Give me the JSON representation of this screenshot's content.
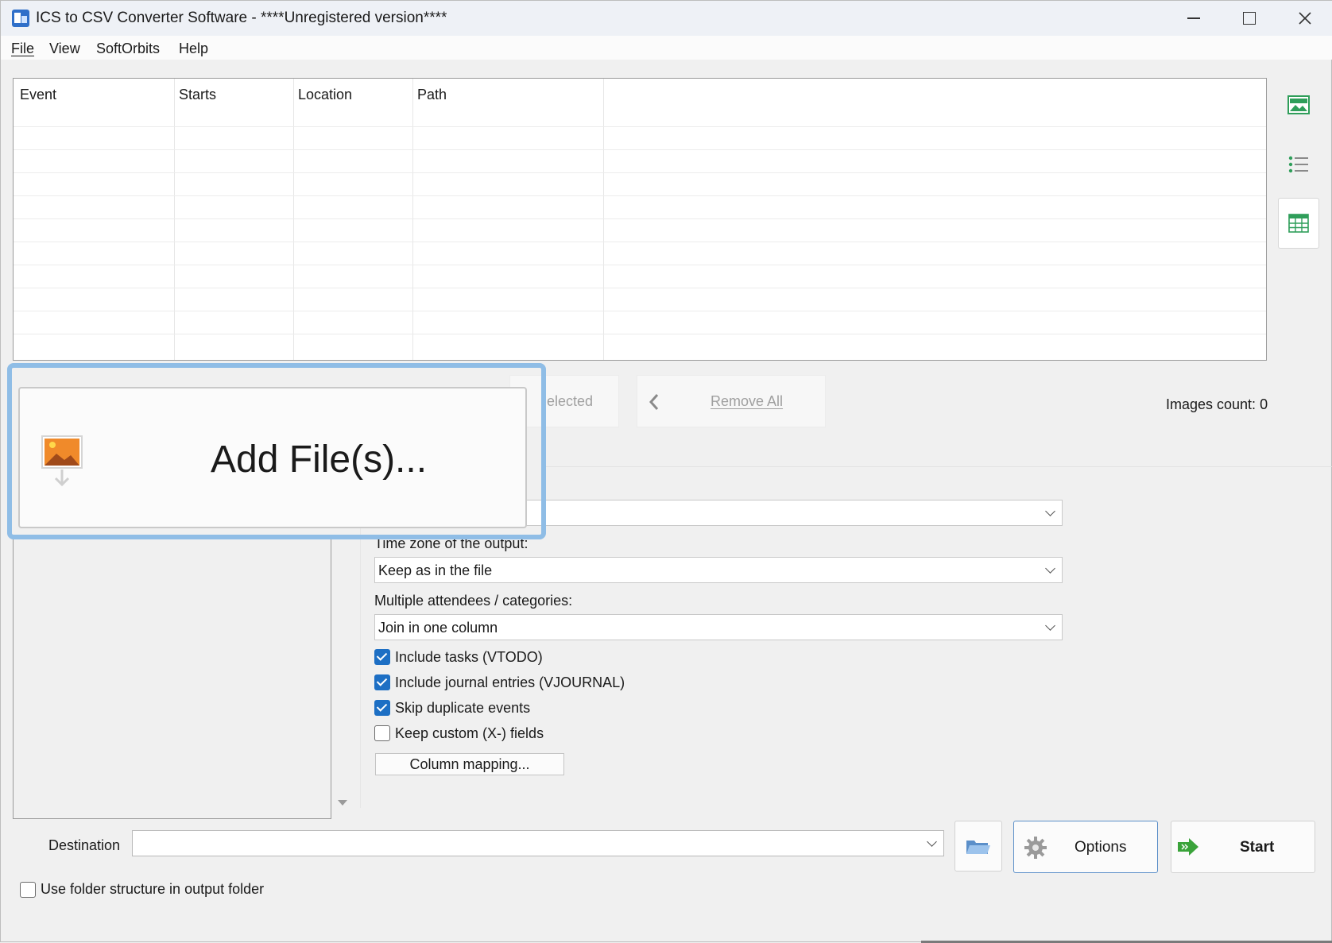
{
  "window": {
    "title": "ICS to CSV Converter Software - ****Unregistered version****"
  },
  "menu": [
    {
      "label": "File"
    },
    {
      "label": "View"
    },
    {
      "label": "SoftOrbits"
    },
    {
      "label": "Help"
    }
  ],
  "table": {
    "columns": [
      "Event",
      "Starts",
      "Location",
      "Path"
    ]
  },
  "side_toolbar": [
    {
      "icon": "picture-icon"
    },
    {
      "icon": "list-icon"
    },
    {
      "icon": "grid-icon"
    }
  ],
  "actions": {
    "add_files_label": "Add File(s)...",
    "remove_selected_label": "elected",
    "remove_all_label": "Remove All",
    "images_count": "Images count: 0"
  },
  "form": {
    "format_select_value": "",
    "timezone_label": "Time zone of the output:",
    "timezone_value": "Keep as in the file",
    "attendees_label": "Multiple attendees / categories:",
    "attendees_value": "Join in one column",
    "checkboxes": [
      {
        "label": "Include tasks (VTODO)",
        "checked": true
      },
      {
        "label": "Include journal entries (VJOURNAL)",
        "checked": true
      },
      {
        "label": "Skip duplicate events",
        "checked": true
      },
      {
        "label": "Keep custom (X-) fields",
        "checked": false
      }
    ],
    "column_mapping_label": "Column mapping..."
  },
  "bottom": {
    "destination_label": "Destination",
    "destination_value": "",
    "options_label": "Options",
    "start_label": "Start",
    "folder_structure_label": "Use folder structure in output folder",
    "folder_structure_checked": false
  },
  "colors": {
    "accent": "#1d6fc4",
    "highlight": "#8fbde6",
    "start_arrow": "#3aa33a"
  }
}
